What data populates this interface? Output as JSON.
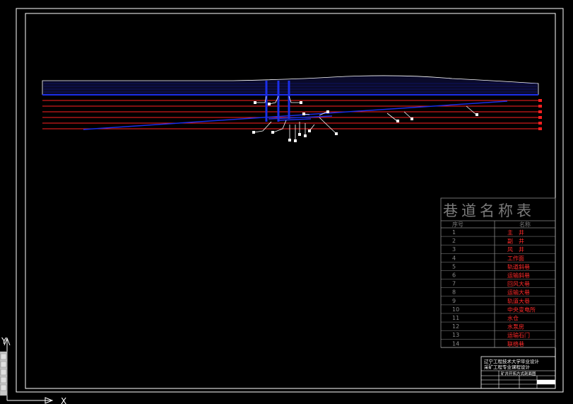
{
  "table": {
    "title": "巷道名称表",
    "col_no": "序号",
    "col_name": "名称",
    "rows": [
      {
        "no": "1",
        "name": "主　井"
      },
      {
        "no": "2",
        "name": "副　井"
      },
      {
        "no": "3",
        "name": "风　井"
      },
      {
        "no": "4",
        "name": "工作面"
      },
      {
        "no": "5",
        "name": "轨道斜巷"
      },
      {
        "no": "6",
        "name": "运输斜巷"
      },
      {
        "no": "7",
        "name": "回风大巷"
      },
      {
        "no": "8",
        "name": "运输大巷"
      },
      {
        "no": "9",
        "name": "轨道大巷"
      },
      {
        "no": "10",
        "name": "中央变电所"
      },
      {
        "no": "11",
        "name": "水仓"
      },
      {
        "no": "12",
        "name": "水泵房"
      },
      {
        "no": "13",
        "name": "运输石门"
      },
      {
        "no": "14",
        "name": "联络巷"
      }
    ]
  },
  "title_block": {
    "line1": "辽宁工程技术大学毕业设计",
    "line2": "采矿工程专业课程设计",
    "drawing_name": "矿井开拓方式剖面图"
  },
  "ucs": {
    "x": "X",
    "y": "Y"
  },
  "colors": {
    "bg": "#000000",
    "frame": "#ffffff",
    "level": "#ff2020",
    "shaft": "#1a2ee8",
    "table_text": "#ff2a2a",
    "table_grey": "#8a8a8a"
  }
}
